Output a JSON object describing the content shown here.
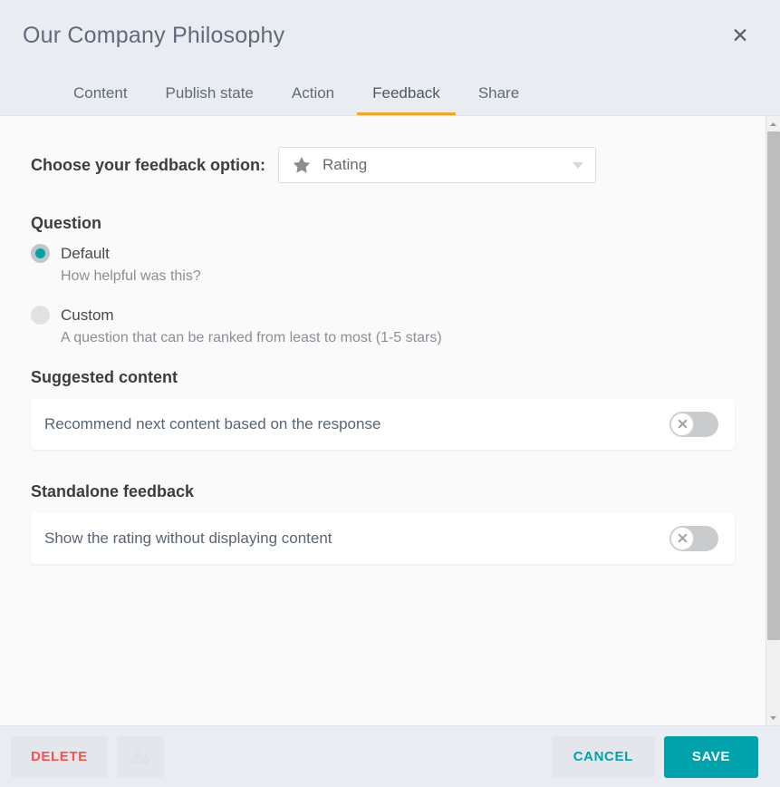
{
  "header": {
    "title": "Our Company Philosophy",
    "close_label": "✕"
  },
  "tabs": [
    {
      "label": "Content",
      "active": false
    },
    {
      "label": "Publish state",
      "active": false
    },
    {
      "label": "Action",
      "active": false
    },
    {
      "label": "Feedback",
      "active": true
    },
    {
      "label": "Share",
      "active": false
    }
  ],
  "feedback_option": {
    "label": "Choose your feedback option:",
    "selected_value": "Rating",
    "icon": "star-icon",
    "dropdown_icon": "chevron-down-icon"
  },
  "question": {
    "title": "Question",
    "options": [
      {
        "label": "Default",
        "hint": "How helpful was this?",
        "selected": true
      },
      {
        "label": "Custom",
        "hint": "A question that can be ranked from least to most (1-5 stars)",
        "selected": false
      }
    ]
  },
  "suggested_content": {
    "title": "Suggested content",
    "row_label": "Recommend next content based on the response",
    "toggle_state": "off",
    "toggle_icon": "close-icon"
  },
  "standalone_feedback": {
    "title": "Standalone feedback",
    "row_label": "Show the rating without displaying content",
    "toggle_state": "off",
    "toggle_icon": "close-icon"
  },
  "footer": {
    "delete_label": "DELETE",
    "permissions_icon": "user-settings-icon",
    "cancel_label": "CANCEL",
    "save_label": "SAVE"
  },
  "colors": {
    "accent_teal": "#00a3a8",
    "active_tab_underline": "#f5a623",
    "delete_red": "#ff4d4d",
    "header_background": "#e9edf1",
    "content_background": "#fafafa"
  },
  "scrollbar": {
    "up_icon": "caret-up-icon",
    "down_icon": "caret-down-icon"
  }
}
